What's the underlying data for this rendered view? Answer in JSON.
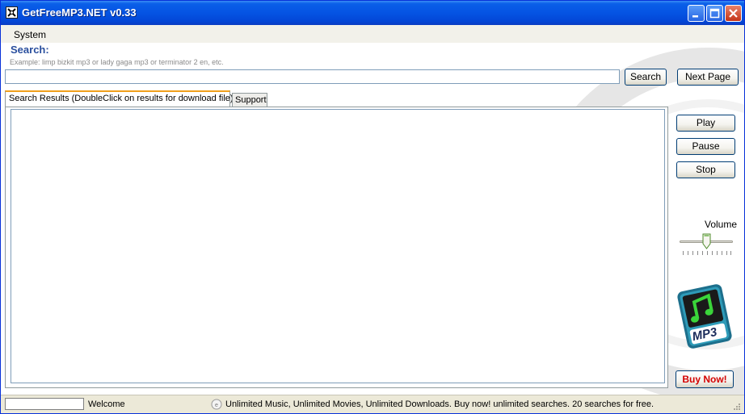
{
  "window": {
    "title": "GetFreeMP3.NET v0.33",
    "controls": [
      "minimize",
      "maximize",
      "close"
    ]
  },
  "menubar": {
    "items": [
      "System"
    ]
  },
  "search": {
    "label": "Search:",
    "example": "Example: limp bizkit mp3    or    lady gaga mp3    or    terminator 2 en,     etc.",
    "value": "",
    "search_button": "Search",
    "next_page_button": "Next Page"
  },
  "tabs": [
    {
      "label": "Search Results (DoubleClick on results for download file)",
      "active": true
    },
    {
      "label": "Support",
      "active": false
    }
  ],
  "results": [],
  "player": {
    "play": "Play",
    "pause": "Pause",
    "stop": "Stop",
    "volume_label": "Volume",
    "volume_level": 0.5
  },
  "logo": {
    "text": "MP3",
    "icon": "music-note-icon"
  },
  "buy_button": "Buy Now!",
  "status": {
    "box_value": "",
    "welcome": "Welcome",
    "message": "Unlimited Music, Unlimited Movies, Unlimited Downloads. Buy now! unlimited searches. 20 searches for free."
  },
  "colors": {
    "title_bar": "#0554e3",
    "search_label": "#2a4f9e",
    "buy_now": "#d40000",
    "active_tab_accent": "#f0a01c"
  }
}
